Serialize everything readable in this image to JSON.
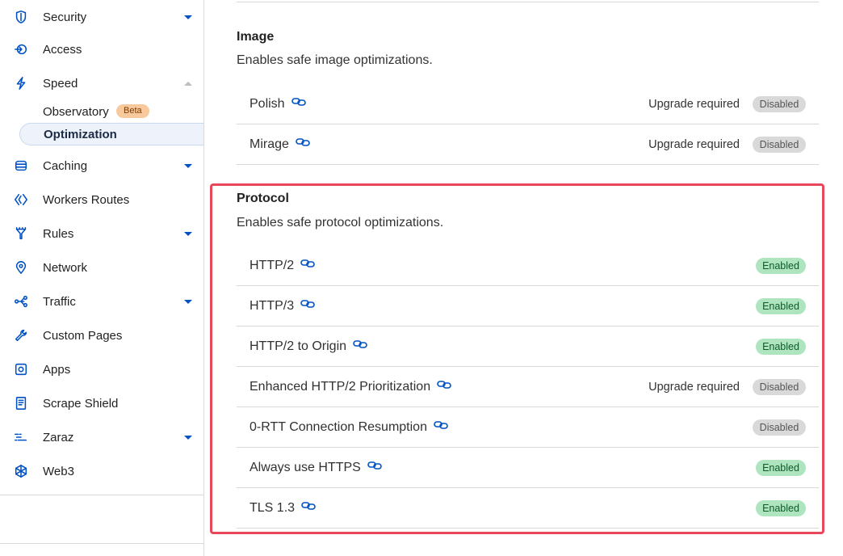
{
  "sidebar": {
    "items": [
      {
        "label": "Security",
        "icon": "shield-icon",
        "caret": true
      },
      {
        "label": "Access",
        "icon": "access-icon",
        "caret": false
      },
      {
        "label": "Speed",
        "icon": "lightning-icon",
        "caret": "up"
      },
      {
        "label": "Caching",
        "icon": "database-icon",
        "caret": true
      },
      {
        "label": "Workers Routes",
        "icon": "workers-icon",
        "caret": false
      },
      {
        "label": "Rules",
        "icon": "rules-icon",
        "caret": true
      },
      {
        "label": "Network",
        "icon": "location-pin-icon",
        "caret": false
      },
      {
        "label": "Traffic",
        "icon": "traffic-icon",
        "caret": true
      },
      {
        "label": "Custom Pages",
        "icon": "wrench-icon",
        "caret": false
      },
      {
        "label": "Apps",
        "icon": "apps-icon",
        "caret": false
      },
      {
        "label": "Scrape Shield",
        "icon": "document-icon",
        "caret": false
      },
      {
        "label": "Zaraz",
        "icon": "zaraz-icon",
        "caret": true
      },
      {
        "label": "Web3",
        "icon": "web3-icon",
        "caret": false
      }
    ],
    "speed_sub": [
      {
        "label": "Observatory",
        "badge": "Beta"
      },
      {
        "label": "Optimization",
        "active": true
      }
    ]
  },
  "image_section": {
    "title": "Image",
    "description": "Enables safe image optimizations.",
    "rows": [
      {
        "label": "Polish",
        "upgrade": "Upgrade required",
        "status": "Disabled"
      },
      {
        "label": "Mirage",
        "upgrade": "Upgrade required",
        "status": "Disabled"
      }
    ]
  },
  "protocol_section": {
    "title": "Protocol",
    "description": "Enables safe protocol optimizations.",
    "rows": [
      {
        "label": "HTTP/2",
        "upgrade": "",
        "status": "Enabled"
      },
      {
        "label": "HTTP/3",
        "upgrade": "",
        "status": "Enabled"
      },
      {
        "label": "HTTP/2 to Origin",
        "upgrade": "",
        "status": "Enabled"
      },
      {
        "label": "Enhanced HTTP/2 Prioritization",
        "upgrade": "Upgrade required",
        "status": "Disabled"
      },
      {
        "label": "0-RTT Connection Resumption",
        "upgrade": "",
        "status": "Disabled"
      },
      {
        "label": "Always use HTTPS",
        "upgrade": "",
        "status": "Enabled"
      },
      {
        "label": "TLS 1.3",
        "upgrade": "",
        "status": "Enabled"
      }
    ]
  },
  "colors": {
    "accent": "#0051c3",
    "highlight": "#e8485a",
    "enabled_bg": "#aee5bf",
    "disabled_bg": "#d9d9d9",
    "beta_bg": "#f8c99c"
  }
}
